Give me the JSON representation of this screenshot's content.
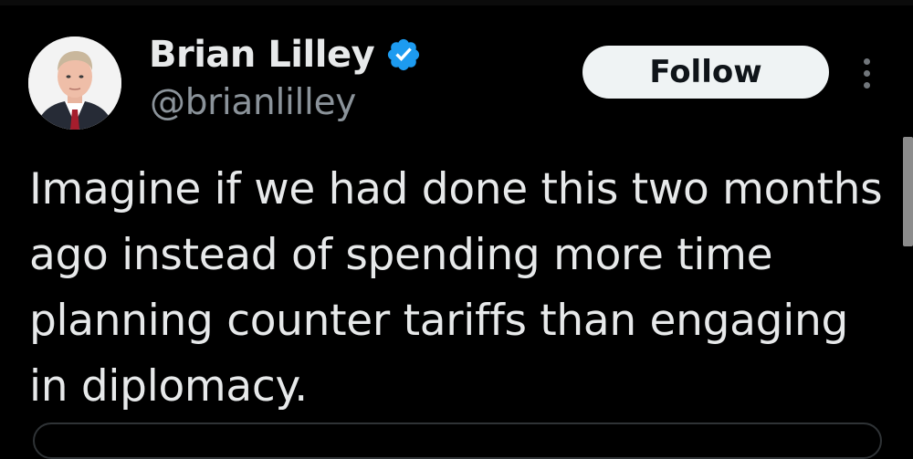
{
  "author": {
    "display_name": "Brian Lilley",
    "handle": "@brianlilley",
    "verified": true,
    "avatar_icon": "profile-photo"
  },
  "actions": {
    "follow_label": "Follow",
    "more_icon": "vertical-ellipsis-icon"
  },
  "tweet": {
    "text": "Imagine if we had done this two months ago instead of spending more time planning counter tariffs than engaging in diplomacy."
  },
  "colors": {
    "background": "#000000",
    "primary_text": "#e7e9ea",
    "secondary_text": "#8b939a",
    "verified_badge": "#1d9bf0",
    "follow_button_bg": "#eff3f4",
    "follow_button_text": "#0f1419"
  }
}
